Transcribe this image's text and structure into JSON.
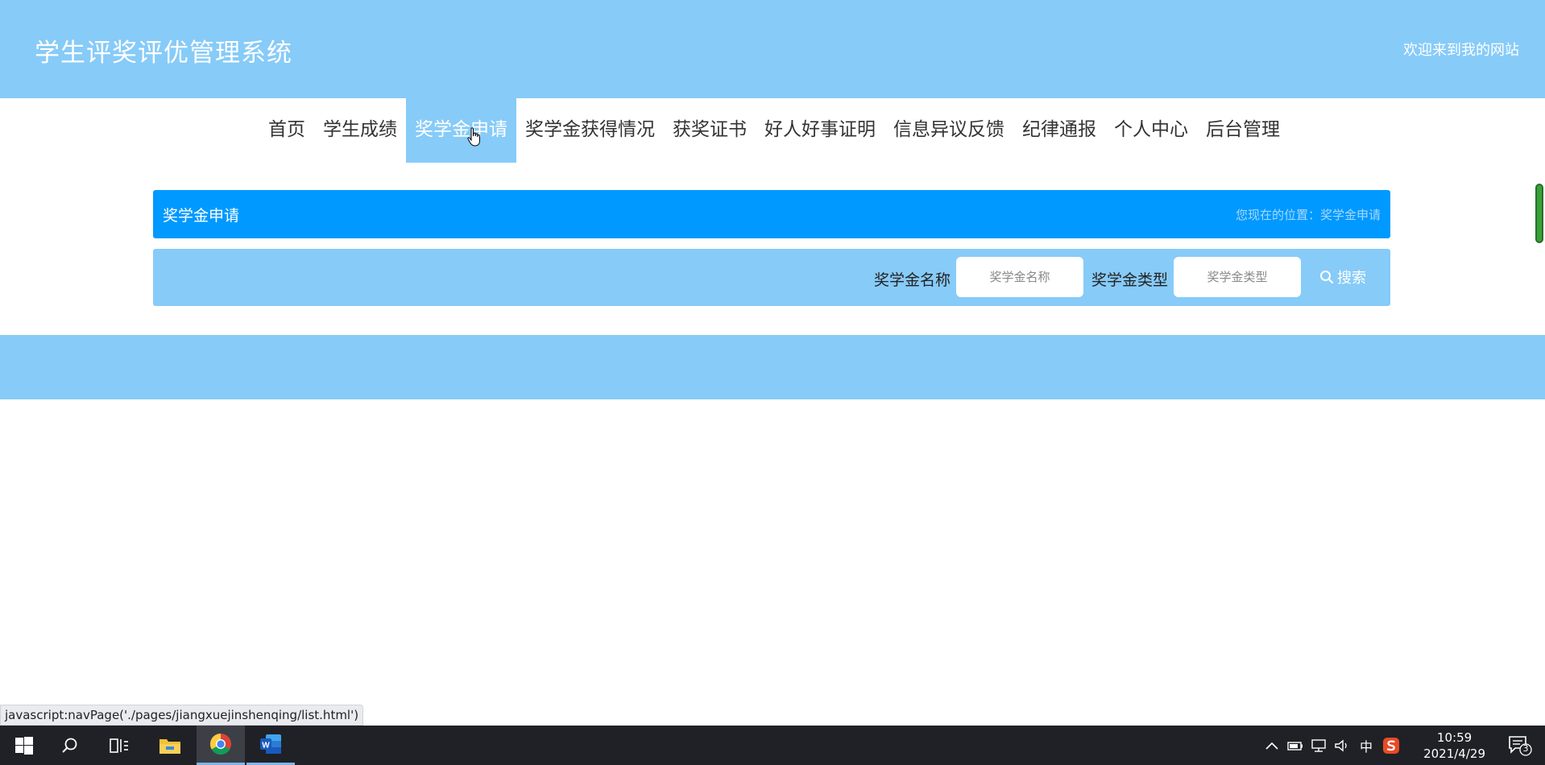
{
  "header": {
    "title": "学生评奖评优管理系统",
    "welcome": "欢迎来到我的网站"
  },
  "nav": {
    "items": [
      {
        "label": "首页"
      },
      {
        "label": "学生成绩"
      },
      {
        "label": "奖学金申请"
      },
      {
        "label": "奖学金获得情况"
      },
      {
        "label": "获奖证书"
      },
      {
        "label": "好人好事证明"
      },
      {
        "label": "信息异议反馈"
      },
      {
        "label": "纪律通报"
      },
      {
        "label": "个人中心"
      },
      {
        "label": "后台管理"
      }
    ],
    "active_index": 2
  },
  "page_title_bar": {
    "title": "奖学金申请",
    "location": "您现在的位置：奖学金申请"
  },
  "search": {
    "name_label": "奖学金名称",
    "name_placeholder": "奖学金名称",
    "type_label": "奖学金类型",
    "type_placeholder": "奖学金类型",
    "button_label": "搜索"
  },
  "status_bar": {
    "url": "javascript:navPage('./pages/jiangxuejinshenqing/list.html')"
  },
  "taskbar": {
    "ime": "中",
    "time": "10:59",
    "date": "2021/4/29",
    "notification_count": "3"
  },
  "colors": {
    "header_bg": "#87cbf8",
    "title_bar_bg": "#0099ff",
    "taskbar_bg": "#1f2126"
  }
}
